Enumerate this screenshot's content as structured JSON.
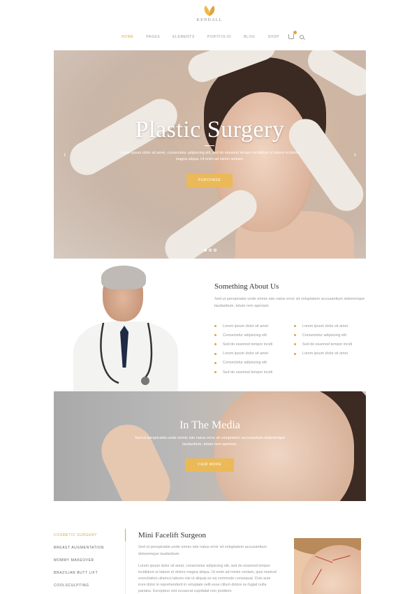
{
  "brand": {
    "name": "KENDALL",
    "accent": "#e2a43b",
    "button_color": "#ebb957"
  },
  "nav": {
    "items": [
      "HOME",
      "PAGES",
      "ELEMENTS",
      "PORTFOLIO",
      "BLOG",
      "SHOP"
    ],
    "active": "HOME",
    "icons": [
      "cart-icon",
      "search-icon"
    ]
  },
  "hero": {
    "title": "Plastic Surgery",
    "text": "Lorem ipsum dolor sit amet, consectetur adipiscing elit, sed do eiusmod tempor incididunt ut labore et dolore magna aliqua. Ut enim ad minim veniam.",
    "button": "PURCHASE",
    "slides": 3,
    "active_slide": 1
  },
  "about": {
    "title": "Something About Us",
    "text": "Sed ut perspiciatis unde omnis iste natus error sit voluptatem accusantium doloremque laudantium, totam rem aperiam.",
    "list_left": [
      "Lorem ipsum dolor sit amet",
      "Consectetur adipiscing elit",
      "Sed do eiusmod tempor incidi",
      "Lorem ipsum dolor sit amet",
      "Consectetur adipiscing elit",
      "Sed do eiusmod tempor incidi"
    ],
    "list_right": [
      "Lorem ipsum dolor sit amet",
      "Consectetur adipiscing elit",
      "Sed do eiusmod tempor incidi",
      "Lorem ipsum dolor sit amet"
    ]
  },
  "media": {
    "title": "In The Media",
    "text": "Sed ut perspiciatis unde omnis iste natus error sit voluptatem accusantium doloremque laudantium, totam rem aperiam.",
    "button": "VIEW MORE"
  },
  "services": {
    "tabs": [
      "COSMETIC SURGERY",
      "BREAST AUGMENTATION",
      "MOMMY MAKEOVER",
      "BRAZILIAN BUTT LIFT",
      "COOLSCULPTING"
    ],
    "active": "COSMETIC SURGERY",
    "title": "Mini Facelift Surgeon",
    "desc": "Sed ut perspiciatis unde omnis iste natus error sit voluptatem accusantium doloremque laudantium.",
    "body": "Lorem ipsum dolor sit amet, consectetur adipiscing elit, sed do eiusmod tempor incididunt ut labore et dolore magna aliqua. Ut enim ad minim veniam, quis nostrud exercitation ullamco laboris nisi ut aliquip ex ea commodo consequat. Duis aute irure dolor in reprehenderit in voluptate velit esse cillum dolore eu fugiat nulla pariatur. Excepteur sint occaecat cupidatat non proident."
  }
}
